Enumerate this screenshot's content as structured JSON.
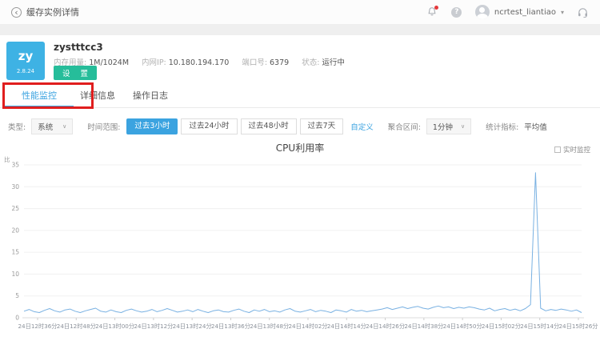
{
  "header": {
    "back_label": "缓存实例详情",
    "username": "ncrtest_liantiao"
  },
  "icons": {
    "back_glyph": "‹",
    "help_glyph": "?",
    "caret_glyph": "▾",
    "dropdown_caret_glyph": "∨"
  },
  "instance": {
    "tile_text": "zy",
    "tile_version": "2.8.24",
    "name": "zystttcc3",
    "fields": [
      {
        "label": "内存用量:",
        "value": "1M/1024M"
      },
      {
        "label": "内网IP:",
        "value": "10.180.194.170"
      },
      {
        "label": "端口号:",
        "value": "6379"
      },
      {
        "label": "状态:",
        "value": "运行中"
      }
    ],
    "settings_label": "设 置"
  },
  "tabs": [
    {
      "label": "性能监控",
      "active": true
    },
    {
      "label": "详细信息",
      "active": false
    },
    {
      "label": "操作日志",
      "active": false
    }
  ],
  "filters": {
    "type_label": "类型:",
    "type_value": "系统",
    "range_label": "时间范围:",
    "range_options": [
      "过去3小时",
      "过去24小时",
      "过去48小时",
      "过去7天"
    ],
    "range_active": "过去3小时",
    "custom_label": "自定义",
    "aggregation_label": "聚合区间:",
    "aggregation_value": "1分钟",
    "metric_label": "统计指标:",
    "metric_value": "平均值"
  },
  "chart": {
    "realtime_label": "实时监控"
  },
  "colors": {
    "accent_blue": "#3ba3e0",
    "tile_blue": "#3eb2e4",
    "button_green": "#26bd9a",
    "annotation_red": "#e01e1e",
    "line_blue": "#79b1e2"
  },
  "chart_data": {
    "type": "line",
    "title": "CPU利用率",
    "series_name": "CPU利用率",
    "ylabel": "比",
    "ylim": [
      0,
      35
    ],
    "yticks": [
      0,
      5,
      10,
      15,
      20,
      25,
      30,
      35
    ],
    "grid": true,
    "legend": "none",
    "xticklabels": [
      "24日12时36分",
      "24日12时48分",
      "24日13时00分",
      "24日13时12分",
      "24日13时24分",
      "24日13时36分",
      "24日13时48分",
      "24日14时02分",
      "24日14时14分",
      "24日14时26分",
      "24日14时38分",
      "24日14时50分",
      "24日15时02分",
      "24日15时14分",
      "24日15时26分"
    ],
    "line_color": "#79b1e2",
    "values": [
      1.5,
      1.9,
      1.4,
      1.2,
      1.7,
      2.1,
      1.6,
      1.3,
      1.8,
      2.0,
      1.5,
      1.2,
      1.6,
      1.9,
      2.2,
      1.5,
      1.3,
      1.8,
      1.4,
      1.2,
      1.7,
      2.0,
      1.6,
      1.3,
      1.5,
      1.9,
      1.4,
      1.7,
      2.1,
      1.7,
      1.3,
      1.5,
      1.8,
      1.4,
      1.9,
      1.5,
      1.2,
      1.6,
      1.8,
      1.4,
      1.3,
      1.7,
      2.0,
      1.5,
      1.2,
      1.8,
      1.5,
      1.9,
      1.4,
      1.6,
      1.3,
      1.8,
      2.1,
      1.5,
      1.3,
      1.6,
      1.9,
      1.4,
      1.7,
      1.5,
      1.2,
      1.8,
      1.6,
      1.3,
      1.9,
      1.5,
      1.7,
      1.4,
      1.6,
      1.8,
      2.0,
      2.3,
      1.9,
      2.2,
      2.5,
      2.1,
      2.4,
      2.6,
      2.2,
      2.0,
      2.4,
      2.7,
      2.3,
      2.5,
      2.1,
      2.4,
      2.2,
      2.5,
      2.3,
      2.0,
      1.8,
      2.2,
      1.6,
      1.9,
      2.1,
      1.7,
      2.0,
      1.6,
      2.1,
      3.0,
      33.2,
      2.2,
      1.6,
      1.9,
      1.7,
      2.0,
      1.8,
      1.5,
      1.8,
      1.2
    ]
  }
}
